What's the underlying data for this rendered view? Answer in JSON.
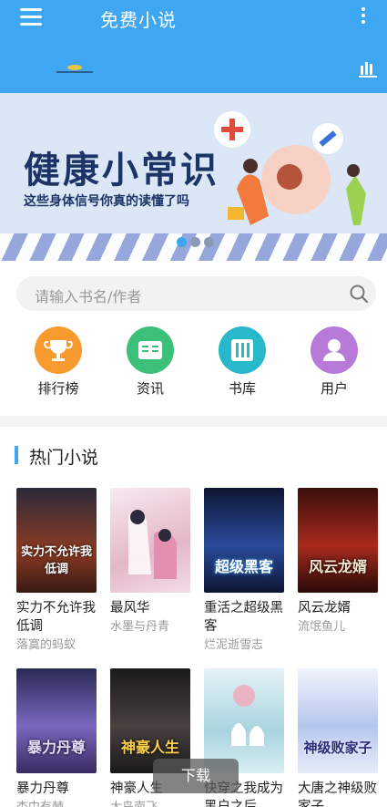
{
  "header": {
    "title": "免费小说",
    "menu_icon": "menu-icon",
    "more_icon": "more-vertical-icon",
    "chart_icon": "bar-chart-icon",
    "color": "#3fa6f2"
  },
  "banner": {
    "title": "健康小常识",
    "subtitle": "这些身体信号你真的读懂了吗",
    "active_dot": 0,
    "dot_count": 3
  },
  "search": {
    "placeholder": "请输入书名/作者"
  },
  "nav": [
    {
      "label": "排行榜",
      "icon": "trophy-icon",
      "color": "#f79b2e"
    },
    {
      "label": "资讯",
      "icon": "news-icon",
      "color": "#3cbf78"
    },
    {
      "label": "书库",
      "icon": "books-icon",
      "color": "#27b9c9"
    },
    {
      "label": "用户",
      "icon": "user-icon",
      "color": "#b77ad8"
    }
  ],
  "section": {
    "title": "热门小说"
  },
  "books": [
    {
      "title": "实力不允许我低调",
      "author": "落寞的蚂蚁",
      "cover_text": "实力不允许我低调",
      "cover_color": "#5a2a1e"
    },
    {
      "title": "最风华",
      "author": "水墨与丹青",
      "cover_text": "",
      "cover_color": "#f1d7e1"
    },
    {
      "title": "重活之超级黑客",
      "author": "烂泥逝雪志",
      "cover_text": "超级黑客",
      "cover_color": "#1b2b5c"
    },
    {
      "title": "风云龙婿",
      "author": "流氓鱼儿",
      "cover_text": "风云龙婿",
      "cover_color": "#7a1b18"
    },
    {
      "title": "暴力丹尊",
      "author": "杏中有棘",
      "cover_text": "暴力丹尊",
      "cover_color": "#5a4c8f"
    },
    {
      "title": "神豪人生",
      "author": "大鸟南飞",
      "cover_text": "神豪人生",
      "cover_color": "#2d2a2a"
    },
    {
      "title": "快穿之我成为黑户之后",
      "author": "",
      "cover_text": "",
      "cover_color": "#bfe3ec"
    },
    {
      "title": "大唐之神级败家子",
      "author": "",
      "cover_text": "神级败家子",
      "cover_color": "#c9d6f0"
    }
  ],
  "download_tip": "下载"
}
